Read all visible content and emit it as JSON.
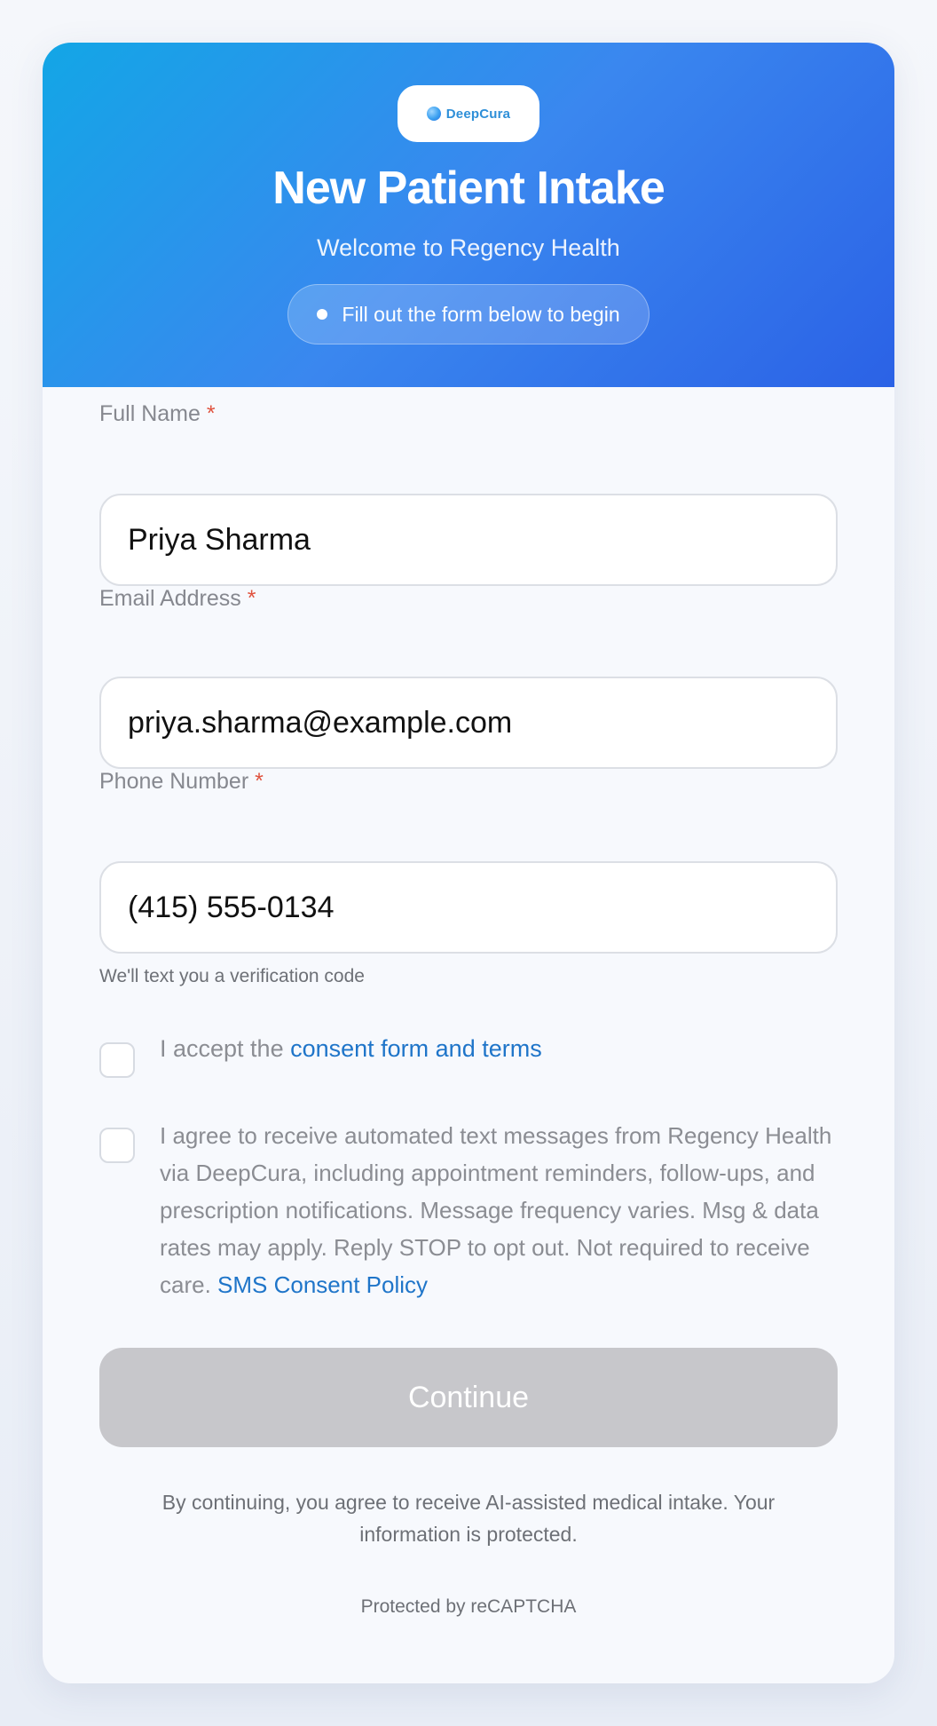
{
  "header": {
    "logo_text": "DeepCura",
    "title": "New Patient Intake",
    "subtitle": "Welcome to Regency Health",
    "status_text": "Fill out the form below to begin"
  },
  "form": {
    "full_name": {
      "label": "Full Name",
      "required_mark": "*",
      "value": "Priya Sharma"
    },
    "email": {
      "label": "Email Address",
      "required_mark": "*",
      "value": "priya.sharma@example.com"
    },
    "phone": {
      "label": "Phone Number",
      "required_mark": "*",
      "value": "(415) 555-0134",
      "hint": "We'll text you a verification code"
    },
    "consent": {
      "prefix": "I accept the ",
      "link_text": "consent form and terms",
      "checked": false
    },
    "sms": {
      "text": "I agree to receive automated text messages from Regency Health via DeepCura, including appointment reminders, follow-ups, and prescription notifications. Message frequency varies. Msg & data rates may apply. Reply STOP to opt out. Not required to receive care. ",
      "link_text": "SMS Consent Policy",
      "checked": false
    },
    "continue_label": "Continue"
  },
  "footer": {
    "disclaimer": "By continuing, you agree to receive AI-assisted medical intake. Your information is protected.",
    "recaptcha": "Protected by reCAPTCHA"
  },
  "colors": {
    "header_gradient_start": "#13a6e6",
    "header_gradient_end": "#2b62e6",
    "link": "#1f75c9",
    "required": "#e0533f",
    "button_disabled": "#c7c7cb"
  }
}
